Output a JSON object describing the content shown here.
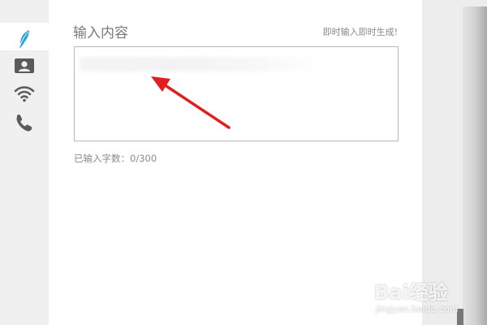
{
  "sidebar": {
    "items": [
      {
        "icon": "feather-icon",
        "active": true
      },
      {
        "icon": "contact-card-icon",
        "active": false
      },
      {
        "icon": "wifi-icon",
        "active": false
      },
      {
        "icon": "phone-icon",
        "active": false
      }
    ],
    "accent_color": "#2aa3dd"
  },
  "main": {
    "title": "输入内容",
    "hint": "即时输入即时生成!",
    "textarea": {
      "value": "",
      "placeholder": ""
    },
    "counter": "已输入字数：0/300"
  },
  "annotation": {
    "arrow_color": "#e02020"
  },
  "watermark": {
    "logo": "Bai经验",
    "url": "jingyan.baidu.com"
  }
}
